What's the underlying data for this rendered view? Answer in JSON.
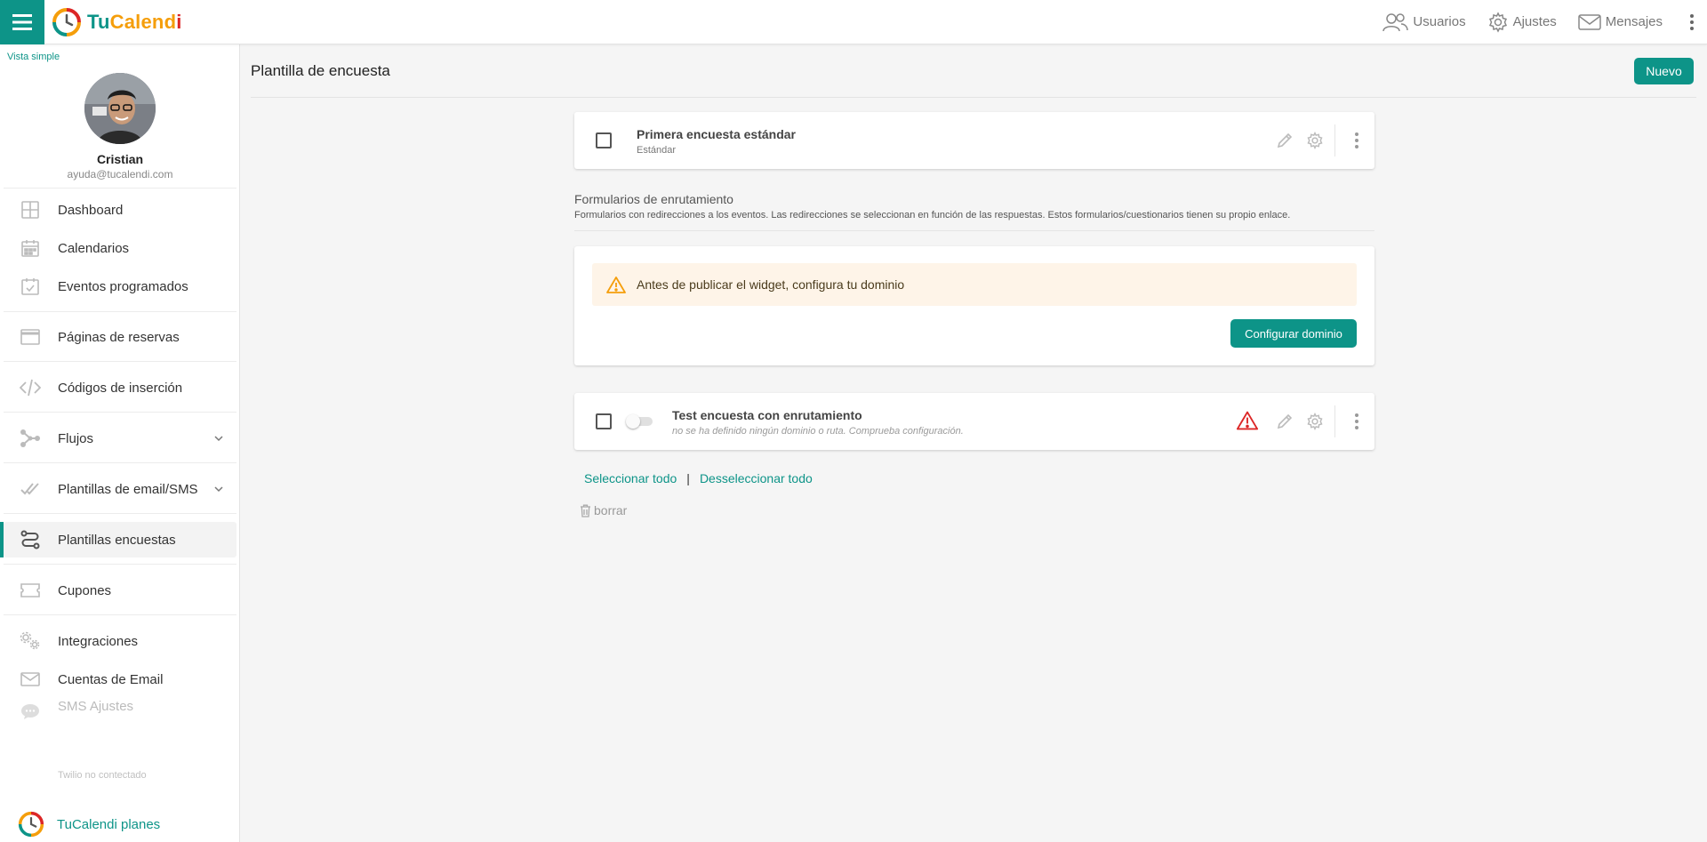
{
  "app": {
    "logo_tu": "Tu",
    "logo_calend": "Calend",
    "logo_i": "i"
  },
  "topbar": {
    "users_label": "Usuarios",
    "settings_label": "Ajustes",
    "messages_label": "Mensajes"
  },
  "sidebar": {
    "simple_view": "Vista simple",
    "user_name": "Cristian",
    "user_email": "ayuda@tucalendi.com",
    "items": [
      {
        "label": "Dashboard",
        "icon": "dashboard-icon"
      },
      {
        "label": "Calendarios",
        "icon": "calendar-icon"
      },
      {
        "label": "Eventos programados",
        "icon": "calendar-check-icon"
      },
      {
        "label": "Páginas de reservas",
        "icon": "browser-window-icon"
      },
      {
        "label": "Códigos de inserción",
        "icon": "code-icon"
      },
      {
        "label": "Flujos",
        "icon": "workflow-icon"
      },
      {
        "label": "Plantillas de email/SMS",
        "icon": "double-check-icon"
      },
      {
        "label": "Plantillas encuestas",
        "icon": "route-icon"
      },
      {
        "label": "Cupones",
        "icon": "coupon-icon"
      },
      {
        "label": "Integraciones",
        "icon": "gears-icon"
      },
      {
        "label": "Cuentas de Email",
        "icon": "envelope-icon"
      },
      {
        "label": "SMS Ajustes",
        "icon": "chat-bubble-icon"
      }
    ],
    "active_item": "Plantillas encuestas",
    "sms_sub": "Twilio no contectado",
    "plans_label": "TuCalendi planes"
  },
  "main": {
    "title": "Plantilla de encuesta",
    "new_button": "Nuevo",
    "standard_survey": {
      "title": "Primera encuesta estándar",
      "subtitle": "Estándar"
    },
    "routing_section": {
      "title": "Formularios de enrutamiento",
      "description": "Formularios con redirecciones a los eventos. Las redirecciones se seleccionan en función de las respuestas. Estos formularios/cuestionarios tienen su propio enlace."
    },
    "warning": {
      "text": "Antes de publicar el widget, configura tu dominio",
      "button": "Configurar dominio"
    },
    "routing_survey": {
      "title": "Test encuesta con enrutamiento",
      "subtitle": "no se ha definido ningún dominio o ruta. Comprueba configuración.",
      "enabled": false
    },
    "select_all": "Seleccionar todo",
    "separator": "|",
    "deselect_all": "Desseleccionar todo",
    "delete_label": "borrar"
  },
  "colors": {
    "accent": "#0d9488",
    "warning": "#f59e0b",
    "danger": "#dc2626"
  }
}
